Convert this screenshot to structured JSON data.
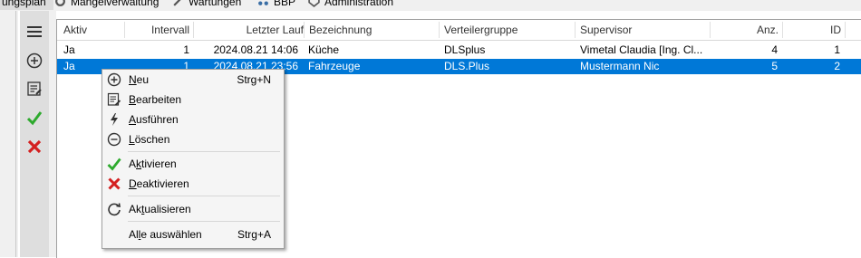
{
  "topmenu": {
    "items": [
      {
        "label": "ungsplan"
      },
      {
        "label": "Mängelverwaltung"
      },
      {
        "label": "Wartungen"
      },
      {
        "label": "BBP"
      },
      {
        "label": "Administration"
      }
    ]
  },
  "toolbar": {
    "icons": [
      "menu-icon",
      "add-circle-icon",
      "edit-list-icon",
      "check-icon",
      "cross-icon"
    ],
    "colors": {
      "check": "#2eaa2e",
      "cross": "#d42020"
    }
  },
  "grid": {
    "columns": [
      "Aktiv",
      "Intervall",
      "Letzter Lauf",
      "Bezeichnung",
      "Verteilergruppe",
      "Supervisor",
      "Anz.",
      "ID"
    ],
    "rows": [
      {
        "aktiv": "Ja",
        "intervall": "1",
        "letzter_lauf": "2024.08.21 14:06",
        "bezeichnung": "Küche",
        "verteilergruppe": "DLSplus",
        "supervisor": "Vimetal Claudia [Ing. Cl...",
        "anz": "4",
        "id": "1",
        "selected": false
      },
      {
        "aktiv": "Ja",
        "intervall": "1",
        "letzter_lauf": "2024.08.21 23:56",
        "bezeichnung": "Fahrzeuge",
        "verteilergruppe": "DLS.Plus",
        "supervisor": "Mustermann Nic",
        "anz": "5",
        "id": "2",
        "selected": true
      }
    ],
    "selection_color": "#0078d7"
  },
  "context_menu": {
    "new": {
      "pre": "",
      "acc": "N",
      "post": "eu",
      "shortcut": "Strg+N"
    },
    "edit": {
      "pre": "",
      "acc": "B",
      "post": "earbeiten"
    },
    "run": {
      "pre": "",
      "acc": "A",
      "post": "usführen"
    },
    "delete": {
      "pre": "",
      "acc": "L",
      "post": "öschen"
    },
    "activate": {
      "pre": "A",
      "acc": "k",
      "post": "tivieren"
    },
    "deactivate": {
      "pre": "",
      "acc": "D",
      "post": "eaktivieren"
    },
    "refresh": {
      "pre": "Ak",
      "acc": "t",
      "post": "ualisieren"
    },
    "select_all": {
      "pre": "Al",
      "acc": "l",
      "post": "e auswählen",
      "shortcut": "Strg+A"
    }
  }
}
